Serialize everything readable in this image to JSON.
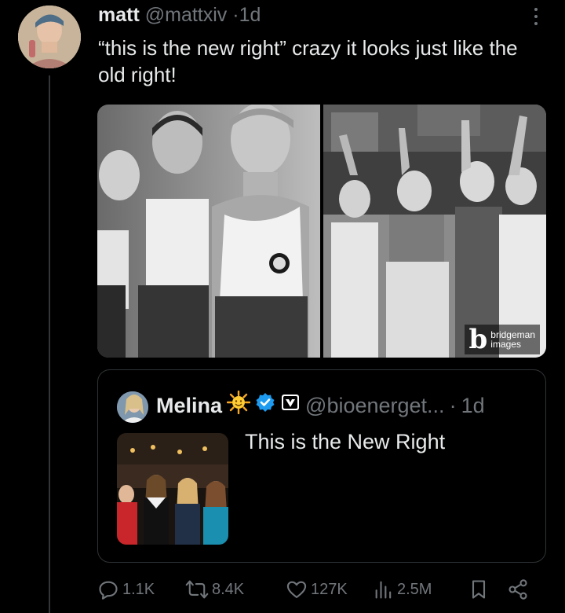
{
  "post": {
    "author_name": "matt",
    "author_handle": "@mattxiv",
    "separator": "·",
    "time": "1d",
    "text": "“this is the new right” crazy it looks just like the old right!",
    "media_watermark": {
      "brand_letter": "b",
      "line1": "bridgeman",
      "line2": "images"
    }
  },
  "quoted_post": {
    "author_name": "Melina",
    "author_handle": "@bioenerget...",
    "separator": "·",
    "time": "1d",
    "text": "This is the New Right"
  },
  "actions": {
    "replies": "1.1K",
    "reposts": "8.4K",
    "likes": "127K",
    "views": "2.5M"
  },
  "colors": {
    "background": "#000000",
    "text": "#e7e9ea",
    "muted": "#71767b",
    "border": "#2f3336",
    "verified": "#1d9bf0"
  },
  "icons": [
    "more-icon",
    "sun-emoji-icon",
    "verified-badge-icon",
    "affiliate-badge-icon",
    "reply-icon",
    "repost-icon",
    "like-icon",
    "views-icon",
    "bookmark-icon",
    "share-icon"
  ]
}
